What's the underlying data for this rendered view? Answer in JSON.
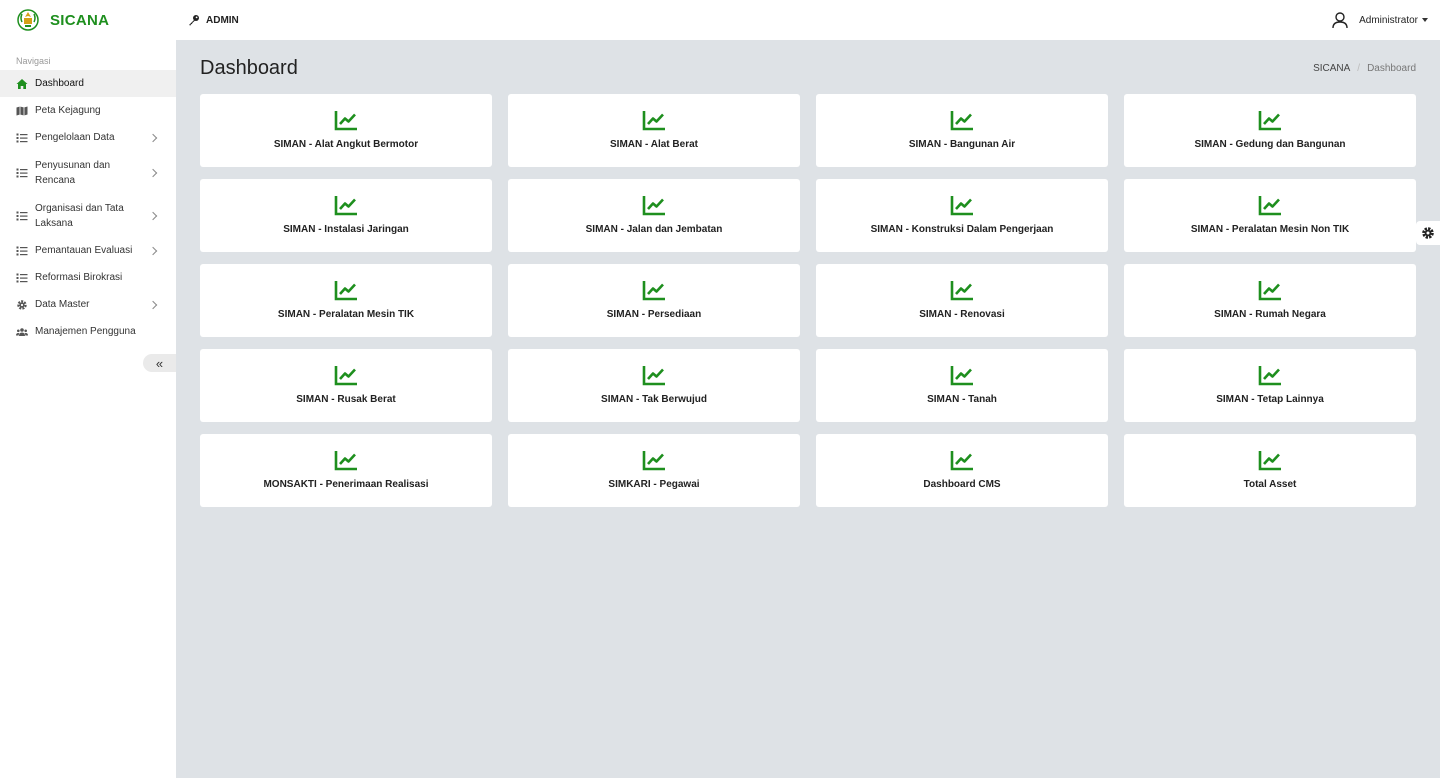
{
  "app": {
    "brand": "SICANA",
    "role": "ADMIN",
    "user": "Administrator"
  },
  "sidebar": {
    "header": "Navigasi",
    "items": [
      {
        "label": "Dashboard",
        "icon": "home-icon"
      },
      {
        "label": "Peta Kejagung",
        "icon": "map-icon"
      },
      {
        "label": "Pengelolaan Data",
        "icon": "list-icon"
      },
      {
        "label": "Penyusunan dan Rencana",
        "icon": "list-icon"
      },
      {
        "label": "Organisasi dan Tata Laksana",
        "icon": "list-icon"
      },
      {
        "label": "Pemantauan Evaluasi",
        "icon": "list-icon"
      },
      {
        "label": "Reformasi Birokrasi",
        "icon": "list-icon"
      },
      {
        "label": "Data Master",
        "icon": "gear-icon"
      },
      {
        "label": "Manajemen Pengguna",
        "icon": "users-icon"
      }
    ],
    "collapse": "«"
  },
  "main": {
    "title": "Dashboard",
    "breadcrumb": [
      "SICANA",
      "Dashboard"
    ],
    "cards": [
      "SIMAN - Alat Angkut Bermotor",
      "SIMAN - Alat Berat",
      "SIMAN - Bangunan Air",
      "SIMAN - Gedung dan Bangunan",
      "SIMAN - Instalasi Jaringan",
      "SIMAN - Jalan dan Jembatan",
      "SIMAN - Konstruksi Dalam Pengerjaan",
      "SIMAN - Peralatan Mesin Non TIK",
      "SIMAN - Peralatan Mesin TIK",
      "SIMAN - Persediaan",
      "SIMAN - Renovasi",
      "SIMAN - Rumah Negara",
      "SIMAN - Rusak Berat",
      "SIMAN - Tak Berwujud",
      "SIMAN - Tanah",
      "SIMAN - Tetap Lainnya",
      "MONSAKTI - Penerimaan Realisasi",
      "SIMKARI - Pegawai",
      "Dashboard CMS",
      "Total Asset"
    ]
  },
  "colors": {
    "accent": "#1e8f1e",
    "background": "#dee2e6"
  }
}
